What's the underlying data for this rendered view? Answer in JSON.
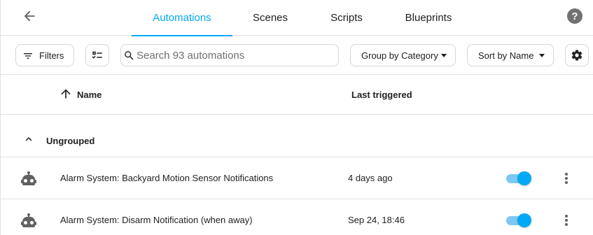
{
  "tabs": [
    {
      "label": "Automations",
      "active": true
    },
    {
      "label": "Scenes",
      "active": false
    },
    {
      "label": "Scripts",
      "active": false
    },
    {
      "label": "Blueprints",
      "active": false
    }
  ],
  "help_icon": "?",
  "toolbar": {
    "filters_label": "Filters",
    "search_placeholder": "Search 93 automations",
    "search_value": "",
    "group_by_label": "Group by Category",
    "sort_by_label": "Sort by Name"
  },
  "table": {
    "columns": {
      "name": "Name",
      "last_triggered": "Last triggered"
    },
    "sort_direction": "ascending",
    "group_label": "Ungrouped",
    "rows": [
      {
        "name": "Alarm System: Backyard Motion Sensor Notifications",
        "last_triggered": "4 days ago",
        "enabled": true
      },
      {
        "name": "Alarm System: Disarm Notification (when away)",
        "last_triggered": "Sep 24, 18:46",
        "enabled": true
      }
    ]
  },
  "colors": {
    "accent": "#03a9f4",
    "toggle_track": "#7cc8f2",
    "icon": "#616161"
  },
  "icons": {
    "back": "arrow-left-icon",
    "help": "help-circle-icon",
    "filters": "filter-variant-icon",
    "multiselect": "checklist-icon",
    "search": "magnify-icon",
    "settings": "gear-icon",
    "sort": "arrow-up-icon",
    "collapse": "chevron-up-icon",
    "row": "robot-icon",
    "overflow": "dots-vertical-icon"
  }
}
